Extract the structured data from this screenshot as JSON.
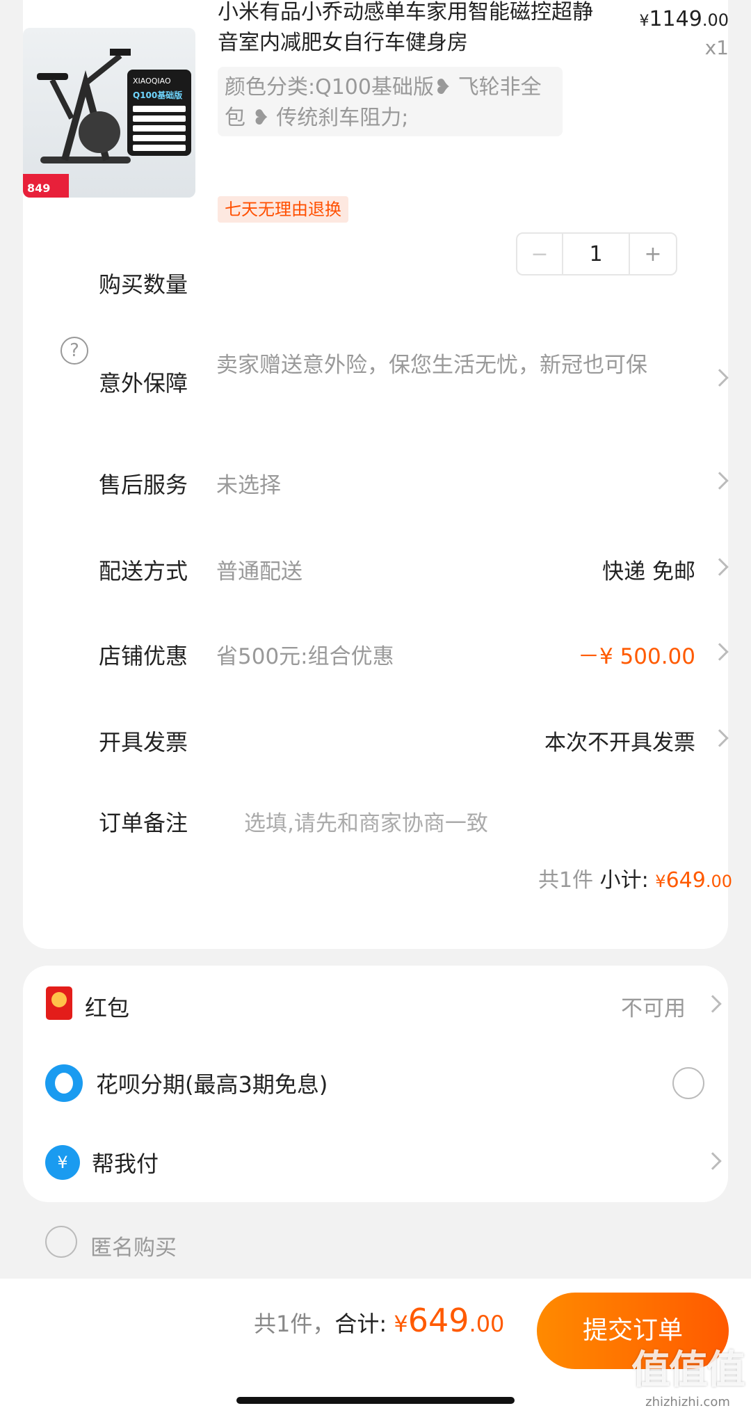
{
  "product": {
    "title": "小米有品小乔动感单车家用智能磁控超静音室内减肥女自行车健身房",
    "price_currency": "¥",
    "price_int": "1149",
    "price_dec": ".00",
    "qty_badge": "x1",
    "spec": "颜色分类:Q100基础版❥ 飞轮非全包 ❥ 传统刹车阻力;",
    "return_tag": "七天无理由退换",
    "image": {
      "brand": "XIAOQIAO",
      "edition": "Q100基础版",
      "price_label": "849"
    }
  },
  "rows": {
    "quantity": {
      "label": "购买数量",
      "value": "1",
      "minus": "−",
      "plus": "+"
    },
    "insurance": {
      "label": "意外保障",
      "value": "卖家赠送意外险，保您生活无忧，新冠也可保",
      "icon": "?"
    },
    "after_sale": {
      "label": "售后服务",
      "value": "未选择"
    },
    "delivery": {
      "label": "配送方式",
      "value": "普通配送",
      "right": "快递 免邮"
    },
    "discount": {
      "label": "店铺优惠",
      "value": "省500元:组合优惠",
      "right": "－¥ 500.00"
    },
    "invoice": {
      "label": "开具发票",
      "right": "本次不开具发票"
    },
    "note": {
      "label": "订单备注",
      "placeholder": "选填,请先和商家协商一致"
    }
  },
  "subtotal": {
    "count": "共1件",
    "label": "小计:",
    "currency": "¥",
    "int": "649",
    "dec": ".00"
  },
  "payment": {
    "red_packet": {
      "label": "红包",
      "status": "不可用"
    },
    "huabei": {
      "label": "花呗分期(最高3期免息)"
    },
    "help_pay": {
      "label": "帮我付",
      "icon": "¥"
    }
  },
  "anonymous": {
    "label": "匿名购买"
  },
  "footer": {
    "count": "共1件，",
    "total_label": "合计:",
    "currency": "¥",
    "int": "649",
    "dec": ".00",
    "submit": "提交订单"
  },
  "watermark": {
    "big": "值值值",
    "small": "zhizhizhi.com"
  },
  "colors": {
    "accent": "#ff5a00",
    "muted": "#999999",
    "background": "#f2f2f2"
  }
}
